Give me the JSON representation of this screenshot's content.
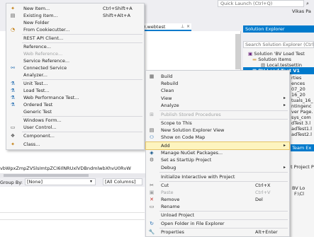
{
  "top_bar": {
    "quick_launch_placeholder": "Quick Launch (Ctrl+Q)",
    "search_icon": "search-icon",
    "user_name": "Vikas Pa"
  },
  "editor": {
    "tab_title": "020.webtest",
    "tab_pin": "⊥",
    "tab_close": "×",
    "connection_string": "vbWpxZmpZVSlsImtpZCI6IlNRUxlVDBndmlwbXhvU0RvW"
  },
  "bottom_panel": {
    "group_by_label": "Group By:",
    "group_by_value": "[None]",
    "columns_value": "[All Columns]"
  },
  "solution_explorer": {
    "title": "Solution Explorer",
    "search_placeholder": "Search Solution Explorer (Ctrl+",
    "items": [
      "Solution 'BV Load Test",
      "Solution Items",
      "Local.testsettin",
      "BV Load Test V1",
      "rties",
      "ences",
      "07_20",
      "16_20",
      "tuals_16_",
      "ntingenc",
      "ver Page.",
      "sys_com",
      "dTest 3.l",
      "adTest1.l",
      "adTest2.l"
    ],
    "team_tab": "Team Ex",
    "props_items": [
      "t Project P",
      "BV Lo",
      "F:\\Cl"
    ]
  },
  "add_menu": {
    "items": [
      {
        "icon": "new-item-icon",
        "label": "New Item...",
        "shortcut": "Ctrl+Shift+A"
      },
      {
        "icon": "existing-item-icon",
        "label": "Existing Item...",
        "shortcut": "Shift+Alt+A"
      },
      {
        "icon": "",
        "label": "New Folder",
        "shortcut": ""
      },
      {
        "icon": "cookiecutter-icon",
        "label": "From Cookiecutter...",
        "shortcut": ""
      },
      {
        "icon": "",
        "label": "REST API Client...",
        "shortcut": ""
      },
      {
        "icon": "",
        "label": "Reference...",
        "shortcut": ""
      },
      {
        "icon": "",
        "label": "Web Reference...",
        "shortcut": ""
      },
      {
        "icon": "",
        "label": "Service Reference...",
        "shortcut": ""
      },
      {
        "icon": "connected-service-icon",
        "label": "Connected Service",
        "shortcut": ""
      },
      {
        "icon": "",
        "label": "Analyzer...",
        "shortcut": ""
      },
      {
        "icon": "unit-test-icon",
        "label": "Unit Test...",
        "shortcut": ""
      },
      {
        "icon": "load-test-icon",
        "label": "Load Test...",
        "shortcut": ""
      },
      {
        "icon": "web-performance-test-icon",
        "label": "Web Performance Test...",
        "shortcut": ""
      },
      {
        "icon": "ordered-test-icon",
        "label": "Ordered Test",
        "shortcut": ""
      },
      {
        "icon": "",
        "label": "Generic Test",
        "shortcut": ""
      },
      {
        "icon": "",
        "label": "Windows Form...",
        "shortcut": ""
      },
      {
        "icon": "user-control-icon",
        "label": "User Control...",
        "shortcut": ""
      },
      {
        "icon": "component-icon",
        "label": "Component...",
        "shortcut": ""
      },
      {
        "icon": "class-icon",
        "label": "Class...",
        "shortcut": ""
      }
    ]
  },
  "context_menu": {
    "items": [
      {
        "icon": "build-icon",
        "label": "Build",
        "shortcut": ""
      },
      {
        "icon": "",
        "label": "Rebuild",
        "shortcut": ""
      },
      {
        "icon": "",
        "label": "Clean",
        "shortcut": ""
      },
      {
        "icon": "",
        "label": "View",
        "shortcut": ""
      },
      {
        "icon": "",
        "label": "Analyze",
        "shortcut": ""
      },
      {
        "icon": "publish-icon",
        "label": "Publish Stored Procedures",
        "shortcut": ""
      },
      {
        "icon": "",
        "label": "Scope to This",
        "shortcut": ""
      },
      {
        "icon": "new-explorer-view-icon",
        "label": "New Solution Explorer View",
        "shortcut": ""
      },
      {
        "icon": "code-map-icon",
        "label": "Show on Code Map",
        "shortcut": ""
      },
      {
        "icon": "",
        "label": "Add",
        "shortcut": ""
      },
      {
        "icon": "nuget-icon",
        "label": "Manage NuGet Packages...",
        "shortcut": ""
      },
      {
        "icon": "startup-gear-icon",
        "label": "Set as StartUp Project",
        "shortcut": ""
      },
      {
        "icon": "",
        "label": "Debug",
        "shortcut": ""
      },
      {
        "icon": "",
        "label": "Initialize Interactive with Project",
        "shortcut": ""
      },
      {
        "icon": "cut-icon",
        "label": "Cut",
        "shortcut": "Ctrl+X"
      },
      {
        "icon": "paste-icon",
        "label": "Paste",
        "shortcut": "Ctrl+V"
      },
      {
        "icon": "remove-icon",
        "label": "Remove",
        "shortcut": "Del"
      },
      {
        "icon": "rename-icon",
        "label": "Rename",
        "shortcut": ""
      },
      {
        "icon": "",
        "label": "Unload Project",
        "shortcut": ""
      },
      {
        "icon": "open-folder-icon",
        "label": "Open Folder in File Explorer",
        "shortcut": ""
      },
      {
        "icon": "properties-icon",
        "label": "Properties",
        "shortcut": "Alt+Enter"
      }
    ]
  },
  "colors": {
    "accent": "#007acc",
    "menu_highlight": "#fdf4bf",
    "remove_red": "#c5312a"
  }
}
